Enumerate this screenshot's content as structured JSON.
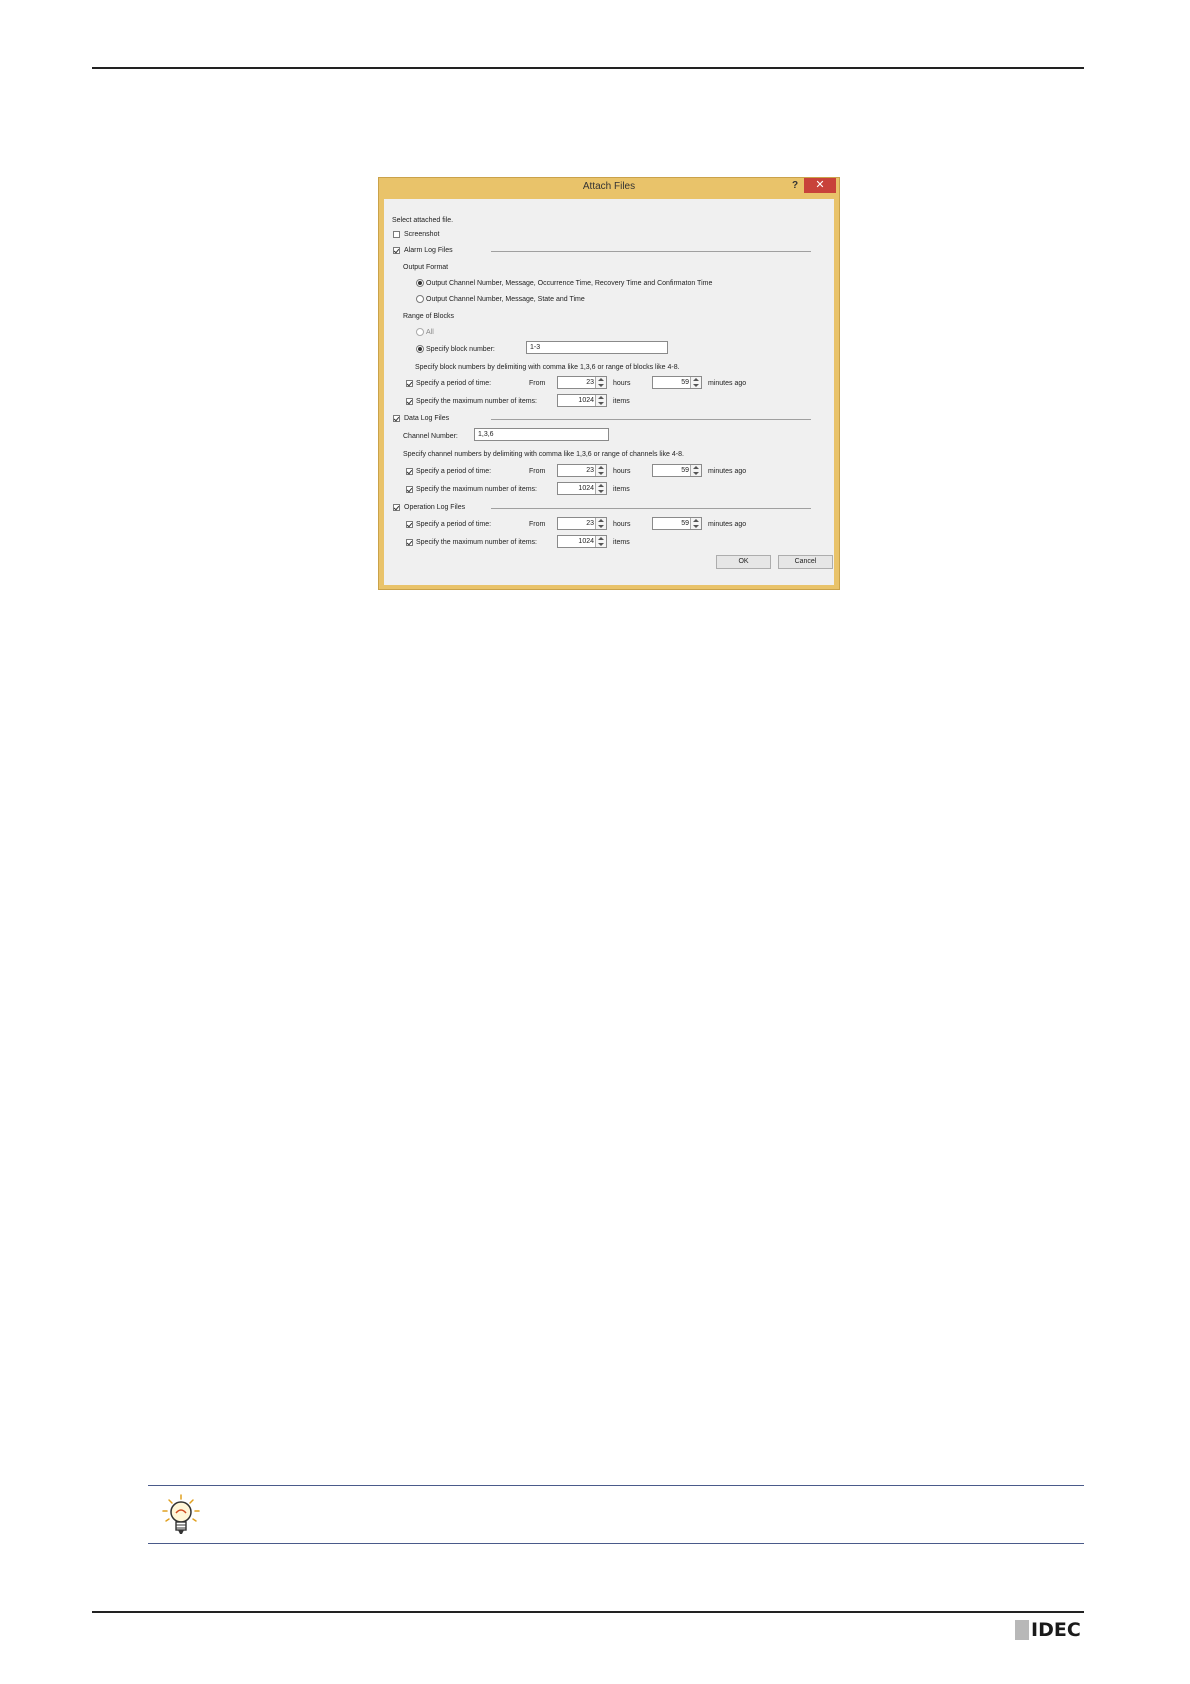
{
  "dialog": {
    "title": "Attach Files",
    "help": "?",
    "close": "✕",
    "intro": "Select attached file.",
    "screenshot": {
      "label": "Screenshot",
      "checked": false
    },
    "alarm": {
      "label": "Alarm Log Files",
      "checked": true,
      "output_format": "Output Format",
      "format_options": [
        {
          "label": "Output Channel Number, Message, Occurrence Time, Recovery Time and Confirmaton Time",
          "selected": true
        },
        {
          "label": "Output Channel Number, Message, State and Time",
          "selected": false
        }
      ],
      "range_label": "Range of Blocks",
      "all_label": "All",
      "specify_block_label": "Specify block number:",
      "block_value": "1-3",
      "block_hint": "Specify block numbers by delimiting with comma like 1,3,6 or range of blocks like 4-8.",
      "period_label": "Specify a period of time:",
      "from": "From",
      "hours_value": "23",
      "hours": "hours",
      "minutes_value": "59",
      "minutes_ago": "minutes ago",
      "max_label": "Specify the maximum number of items:",
      "max_value": "1024",
      "items": "items"
    },
    "data": {
      "label": "Data Log Files",
      "checked": true,
      "channel_label": "Channel Number:",
      "channel_value": "1,3,6",
      "channel_hint": "Specify channel numbers by delimiting with comma like 1,3,6 or range of channels like 4-8.",
      "period_label": "Specify a period of time:",
      "from": "From",
      "hours_value": "23",
      "hours": "hours",
      "minutes_value": "59",
      "minutes_ago": "minutes ago",
      "max_label": "Specify the maximum number of items:",
      "max_value": "1024",
      "items": "items"
    },
    "operation": {
      "label": "Operation Log Files",
      "checked": true,
      "period_label": "Specify a period of time:",
      "from": "From",
      "hours_value": "23",
      "hours": "hours",
      "minutes_value": "59",
      "minutes_ago": "minutes ago",
      "max_label": "Specify the maximum number of items:",
      "max_value": "1024",
      "items": "items"
    },
    "ok": "OK",
    "cancel": "Cancel"
  },
  "tip_icon": "lightbulb-icon",
  "logo": {
    "text": "IDEC"
  },
  "colors": {
    "dialog_frame": "#e9c36a",
    "close": "#c8423a",
    "rule": "#4a5a8a"
  }
}
